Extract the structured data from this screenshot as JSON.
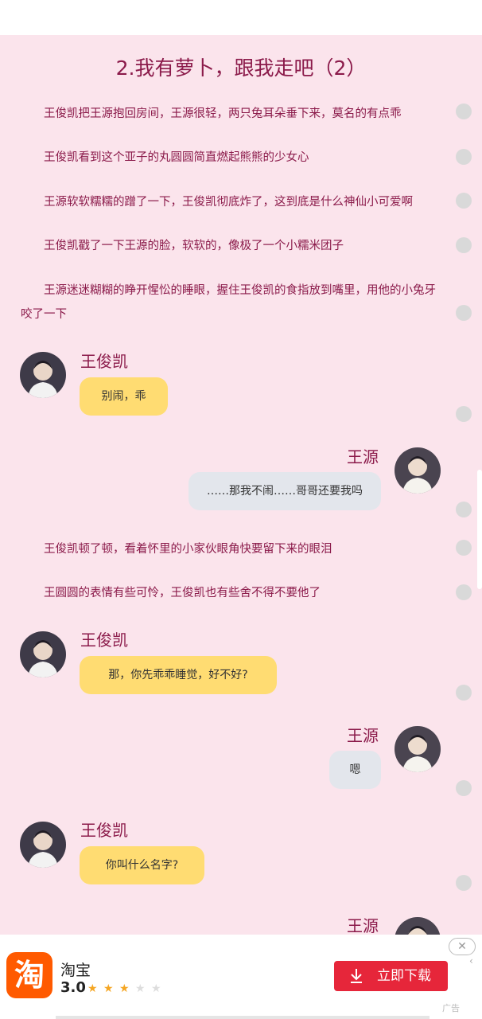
{
  "chapter_title": "2.我有萝卜，跟我走吧（2）",
  "paragraphs": [
    "王俊凯把王源抱回房间，王源很轻，两只兔耳朵垂下来，莫名的有点乖",
    "王俊凯看到这个亚子的丸圆圆简直燃起熊熊的少女心",
    "王源软软糯糯的蹭了一下，王俊凯彻底炸了，这到底是什么神仙小可爱啊",
    "王俊凯戳了一下王源的脸，软软的，像极了一个小糯米团子",
    "王源迷迷糊糊的睁开惺忪的睡眼，握住王俊凯的食指放到嘴里，用他的小兔牙咬了一下",
    "王俊凯顿了顿，看着怀里的小家伙眼角快要留下来的眼泪",
    "王圆圆的表情有些可怜，王俊凯也有些舍不得不要他了"
  ],
  "messages": [
    {
      "speaker": "王俊凯",
      "text": "别闹，乖"
    },
    {
      "speaker": "王源",
      "text": "……那我不闹……哥哥还要我吗"
    },
    {
      "speaker": "王俊凯",
      "text": "那，你先乖乖睡觉，好不好?"
    },
    {
      "speaker": "王源",
      "text": "嗯"
    },
    {
      "speaker": "王俊凯",
      "text": "你叫什么名字?"
    },
    {
      "speaker": "王源",
      "text": ""
    }
  ],
  "ad": {
    "logo_char": "淘",
    "app_name": "淘宝",
    "rating": "3.0",
    "rating_stars": 3,
    "max_stars": 5,
    "download_label": "立即下载",
    "close_symbol": "✕",
    "side_mark": "‹",
    "tag": "广告",
    "download_icon": "download-icon"
  },
  "colors": {
    "page_bg": "#fbe4ec",
    "text": "#8b1a4a",
    "bubble_left": "#ffdc72",
    "bubble_right": "#e3e6ec",
    "ad_button": "#e6263a",
    "taobao_orange": "#ff5a00"
  }
}
